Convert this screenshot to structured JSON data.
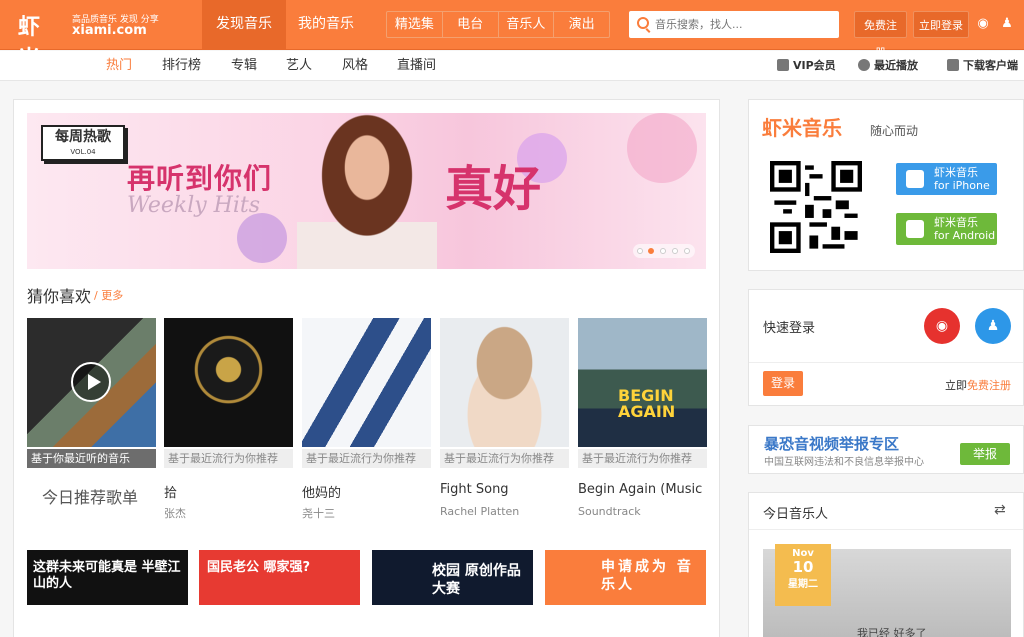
{
  "header": {
    "logo_main": "虾米",
    "logo_slogan": "高品质音乐 发现 分享",
    "logo_domain": "xiami.com",
    "nav": [
      {
        "label": "发现音乐",
        "active": true
      },
      {
        "label": "我的音乐",
        "active": false
      }
    ],
    "subnav": [
      "精选集",
      "电台",
      "音乐人",
      "演出"
    ],
    "search_placeholder": "音乐搜索，找人...",
    "register_label": "免费注册",
    "login_label": "立即登录"
  },
  "secondary_nav": {
    "items": [
      {
        "label": "热门",
        "active": true
      },
      {
        "label": "排行榜"
      },
      {
        "label": "专辑"
      },
      {
        "label": "艺人"
      },
      {
        "label": "风格"
      },
      {
        "label": "直播间"
      }
    ],
    "right": [
      "VIP会员",
      "最近播放",
      "下载客户端"
    ]
  },
  "banner": {
    "tag": "每周热歌",
    "tag_vol": "VOL.04",
    "headline": "再听到你们",
    "subline": "Weekly Hits",
    "big": "真好",
    "slides": 5,
    "active_slide": 1
  },
  "guess": {
    "title": "猜你喜欢",
    "more": "/ 更多",
    "today_playlist": "今日推荐歌单",
    "cards": [
      {
        "caption": "基于你最近听的音乐",
        "song": "",
        "artist": ""
      },
      {
        "caption": "基于最近流行为你推荐",
        "song": "拾",
        "artist": "张杰"
      },
      {
        "caption": "基于最近流行为你推荐",
        "song": "他妈的",
        "artist": "尧十三"
      },
      {
        "caption": "基于最近流行为你推荐",
        "song": "Fight Song",
        "artist": "Rachel Platten"
      },
      {
        "caption": "基于最近流行为你推荐",
        "song": "Begin Again (Music ...",
        "artist": "Soundtrack"
      }
    ]
  },
  "ads": [
    {
      "text": "这群未来可能真是 半壁江山的人"
    },
    {
      "text": "国民老公 哪家强?"
    },
    {
      "text": "校园 原创作品大赛"
    },
    {
      "text": "申请成为 音乐人"
    }
  ],
  "app_promo": {
    "brand": "虾米音乐",
    "tagline": "随心而动",
    "iphone_line1": "虾米音乐",
    "iphone_line2": "for iPhone",
    "android_line1": "虾米音乐",
    "android_line2": "for Android"
  },
  "quick_login": {
    "title": "快速登录",
    "login_button": "登录",
    "register_prefix": "立即",
    "register_link": "免费注册"
  },
  "report": {
    "title": "暴恐音视频举报专区",
    "subtitle": "中国互联网违法和不良信息举报中心",
    "button": "举报"
  },
  "musician": {
    "title": "今日音乐人",
    "month": "Nov",
    "day": "10",
    "weekday": "星期二",
    "cover_text": "我已经 好多了"
  },
  "colors": {
    "brand": "#fa7d3c",
    "green": "#6eb93a",
    "ios_blue": "#3a9be9",
    "weibo_red": "#e6322e",
    "qq_blue": "#2d97e8"
  }
}
